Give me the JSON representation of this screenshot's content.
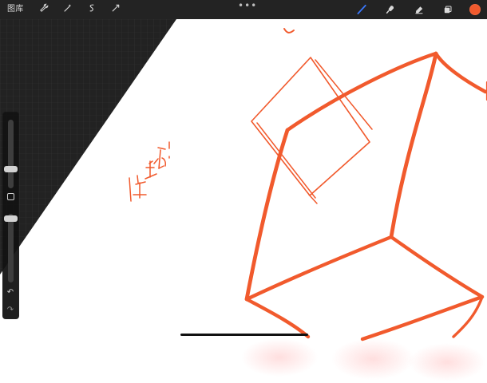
{
  "app": {
    "gallery_label": "图库",
    "more_label": "•••",
    "sidebar": {
      "undo_label": "↶",
      "redo_label": "↷"
    },
    "icons": {
      "wrench": "wrench-icon",
      "wand": "wand-icon",
      "selection": "selection-icon",
      "transform": "transform-icon",
      "brush": "brush-icon",
      "smudge": "smudge-icon",
      "eraser": "eraser-icon",
      "layers": "layers-icon"
    },
    "colors": {
      "accent": "#3a79ff",
      "stroke": "#f15a2d",
      "toolbar": "#1a1a1a",
      "grid_bg": "#1f1f1f"
    }
  }
}
